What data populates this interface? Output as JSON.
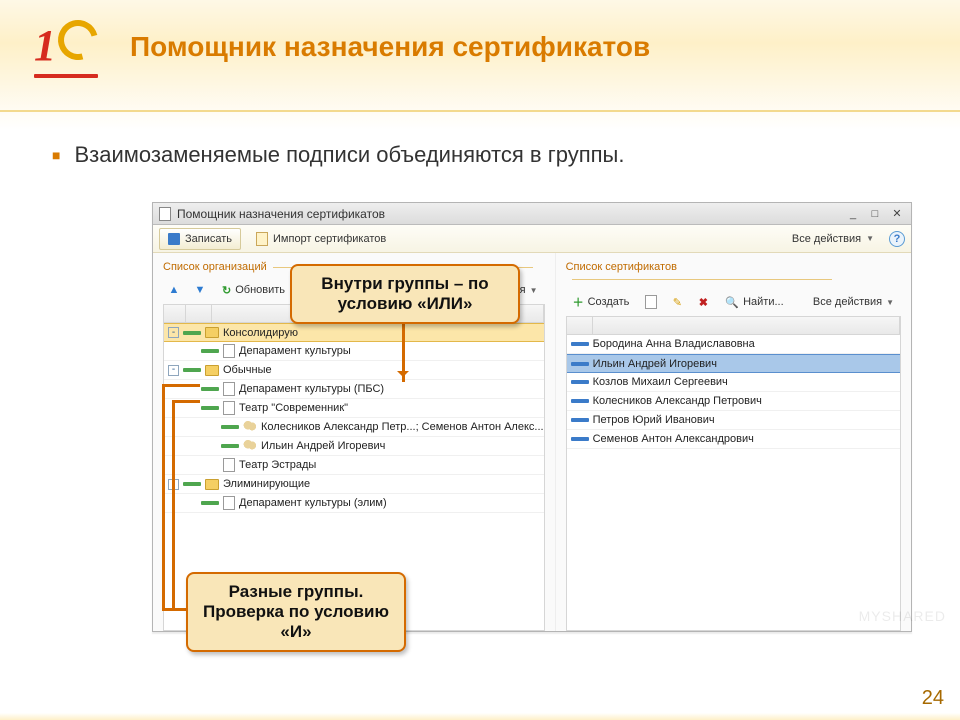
{
  "slide": {
    "title": "Помощник назначения сертификатов",
    "bullet": "Взаимозаменяемые подписи объединяются в группы.",
    "page_number": "24"
  },
  "window": {
    "title": "Помощник назначения сертификатов",
    "toolbar": {
      "save_label": "Записать",
      "import_label": "Импорт сертификатов",
      "all_actions_label": "Все действия"
    }
  },
  "left_panel": {
    "legend": "Список организаций",
    "toolbar": {
      "refresh_label": "Обновить",
      "all_actions_label": "Все действия"
    },
    "tree": [
      {
        "type": "folder",
        "toggle": "-",
        "marker": "green",
        "label": "Консолидирую",
        "level": 0,
        "selected": true
      },
      {
        "type": "file",
        "marker": "green",
        "label": "Депарамент культуры",
        "level": 1
      },
      {
        "type": "folder",
        "toggle": "-",
        "marker": "green",
        "label": "Обычные",
        "level": 0
      },
      {
        "type": "file",
        "marker": "green",
        "label": "Депарамент культуры (ПБС)",
        "level": 1
      },
      {
        "type": "file",
        "marker": "green",
        "label": "Театр \"Современник\"",
        "level": 1
      },
      {
        "type": "people",
        "marker": "green",
        "label": "Колесников Александр Петр...; Семенов Антон Алекс...",
        "level": 2
      },
      {
        "type": "people",
        "marker": "green",
        "label": "Ильин Андрей Игоревич",
        "level": 2
      },
      {
        "type": "file",
        "label": "Театр Эстрады",
        "level": 1
      },
      {
        "type": "folder",
        "toggle": "-",
        "marker": "green",
        "label": "Элиминирующие",
        "level": 0
      },
      {
        "type": "file",
        "marker": "green",
        "label": "Депарамент культуры (элим)",
        "level": 1
      }
    ]
  },
  "right_panel": {
    "legend": "Список сертификатов",
    "toolbar": {
      "create_label": "Создать",
      "find_label": "Найти...",
      "all_actions_label": "Все действия"
    },
    "items": [
      {
        "marker": "blue",
        "label": "Бородина Анна Владиславовна"
      },
      {
        "marker": "blue",
        "label": "Ильин Андрей Игоревич",
        "selected": true
      },
      {
        "marker": "blue",
        "label": "Козлов Михаил Сергеевич"
      },
      {
        "marker": "blue",
        "label": "Колесников Александр Петрович"
      },
      {
        "marker": "blue",
        "label": "Петров Юрий Иванович"
      },
      {
        "marker": "blue",
        "label": "Семенов Антон Александрович"
      }
    ]
  },
  "callouts": {
    "top": "Внутри группы – по условию «ИЛИ»",
    "bottom": "Разные группы. Проверка по условию «И»"
  },
  "watermark": "MYSHARED"
}
